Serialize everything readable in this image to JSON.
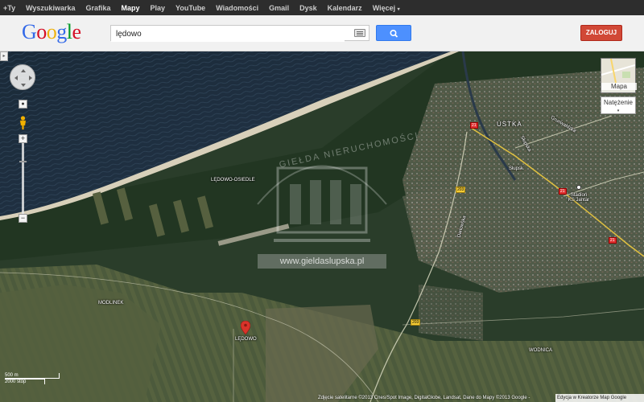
{
  "topbar": {
    "items": [
      {
        "label": "+Ty",
        "active": false
      },
      {
        "label": "Wyszukiwarka",
        "active": false
      },
      {
        "label": "Grafika",
        "active": false
      },
      {
        "label": "Mapy",
        "active": true
      },
      {
        "label": "Play",
        "active": false
      },
      {
        "label": "YouTube",
        "active": false
      },
      {
        "label": "Wiadomości",
        "active": false
      },
      {
        "label": "Gmail",
        "active": false
      },
      {
        "label": "Dysk",
        "active": false
      },
      {
        "label": "Kalendarz",
        "active": false
      },
      {
        "label": "Więcej",
        "active": false
      }
    ]
  },
  "header": {
    "logo_letters": [
      "G",
      "o",
      "o",
      "g",
      "l",
      "e"
    ],
    "logo_colors": [
      "#3369e8",
      "#d50f25",
      "#eeb211",
      "#3369e8",
      "#009925",
      "#d50f25"
    ],
    "search_value": "lędowo",
    "login_label": "ZALOGUJ"
  },
  "map": {
    "map_type_label": "Mapa",
    "traffic_label": "Natężenie",
    "place_labels": [
      {
        "name": "USTKA"
      },
      {
        "name": "LĘDOWO-OSIEDLE"
      },
      {
        "name": "MODLINEK"
      },
      {
        "name": "LĘDOWO"
      },
      {
        "name": "WODNICA"
      },
      {
        "name": "Stadion KS Jantar"
      },
      {
        "name": "Grunwaldzka"
      },
      {
        "name": "Darłowska"
      },
      {
        "name": "Słupska"
      },
      {
        "name": "Słupsk"
      }
    ],
    "road_numbers": [
      "21",
      "203",
      "21",
      "203",
      "21"
    ],
    "watermark": "www.gieldaslupska.pl",
    "watermark_arc": "GIEŁDA NIERUCHOMOŚCI",
    "scale": {
      "metric": "500 m",
      "imperial": "2000 stóp"
    },
    "attribution": "Zdjęcie satelitarne ©2013 Cnes/Spot Image, DigitalGlobe, Landsat, Dane do Mapy ©2013 Google -",
    "report_label": "Edycja w Kreatorze Map Google"
  },
  "colors": {
    "topbar_bg": "#2d2d2d",
    "search_button": "#4d90fe",
    "login_button": "#d14836",
    "sea": "#1b2a36",
    "forest": "#263a26",
    "field": "#4e5a3e",
    "beach": "#cfc7b2",
    "marker": "#d9332a"
  }
}
